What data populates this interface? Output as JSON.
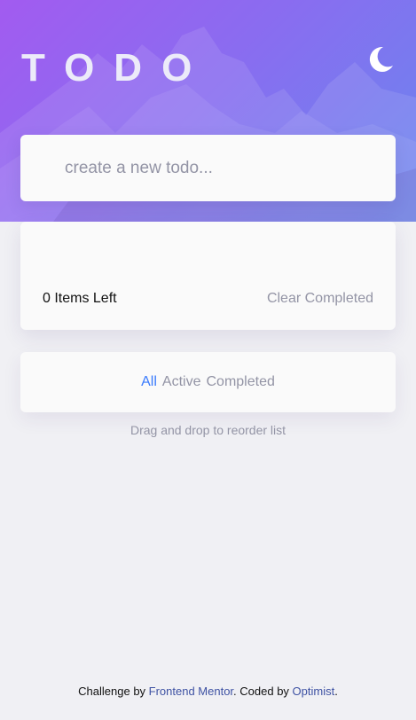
{
  "header": {
    "title": "TODO",
    "theme_icon": "moon-icon"
  },
  "new_todo": {
    "placeholder": "create a new todo...",
    "value": ""
  },
  "list": {
    "items": [],
    "items_left_label": "0 Items Left",
    "clear_completed_label": "Clear Completed"
  },
  "filters": {
    "all": "All",
    "active": "Active",
    "completed": "Completed",
    "selected": "All"
  },
  "hint": "Drag and drop to reorder list",
  "attribution": {
    "prefix": "Challenge by ",
    "frontend_mentor": "Frontend Mentor",
    "middle": ". Coded by ",
    "author": "Optimist",
    "suffix": "."
  },
  "colors": {
    "accent": "#3a7bfd",
    "muted": "#9394a5",
    "card": "#fafafa",
    "page_bg": "#f0f0f4",
    "gradient_start": "#a25bf0",
    "gradient_end": "#6a86ee"
  }
}
